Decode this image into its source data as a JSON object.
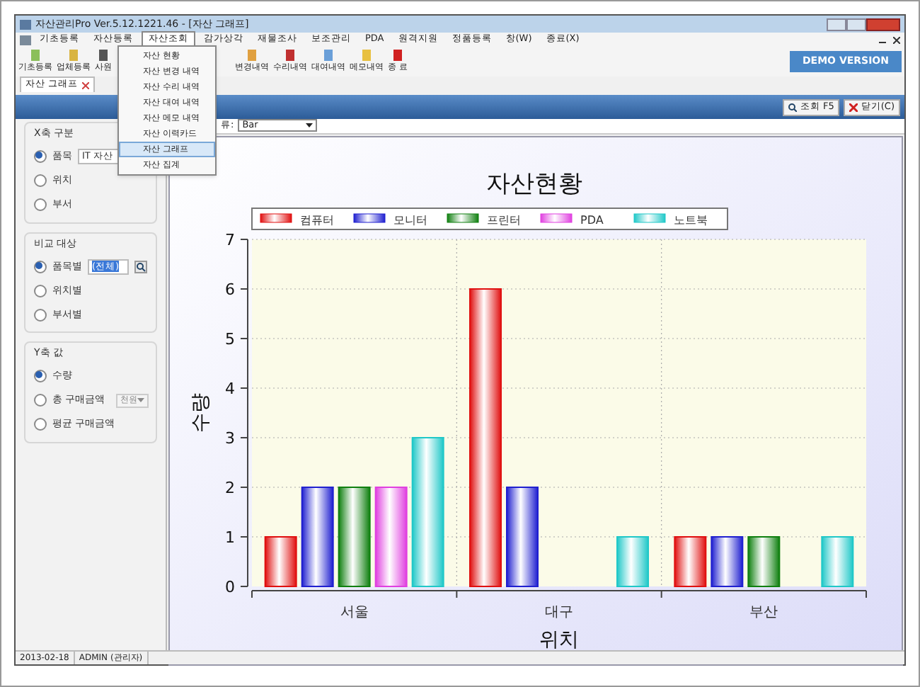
{
  "window": {
    "title": "자산관리Pro Ver.5.12.1221.46 - [자산 그래프]"
  },
  "menu": [
    {
      "label": "기초등록",
      "selected": false
    },
    {
      "label": "자산등록",
      "selected": false
    },
    {
      "label": "자산조회",
      "selected": true
    },
    {
      "label": "감가상각",
      "selected": false
    },
    {
      "label": "재물조사",
      "selected": false
    },
    {
      "label": "보조관리",
      "selected": false
    },
    {
      "label": "PDA",
      "selected": false
    },
    {
      "label": "원격지원",
      "selected": false
    },
    {
      "label": "정품등록",
      "selected": false
    },
    {
      "label": "창(W)",
      "selected": false
    },
    {
      "label": "종료(X)",
      "selected": false
    }
  ],
  "demo_badge": "DEMO VERSION",
  "toolbar": [
    {
      "label": "기초등록"
    },
    {
      "label": "업체등록"
    },
    {
      "label": "사원"
    },
    {
      "label": "변경내역"
    },
    {
      "label": "수리내역"
    },
    {
      "label": "대여내역"
    },
    {
      "label": "메모내역"
    },
    {
      "label": "종 료"
    }
  ],
  "dropdown": [
    {
      "label": "자산 현황",
      "selected": false
    },
    {
      "label": "자산 변경 내역",
      "selected": false
    },
    {
      "label": "자산 수리 내역",
      "selected": false
    },
    {
      "label": "자산 대여 내역",
      "selected": false
    },
    {
      "label": "자산 메모 내역",
      "selected": false
    },
    {
      "label": "자산 이력카드",
      "selected": false
    },
    {
      "label": "자산 그래프",
      "selected": true
    },
    {
      "label": "자산 집계",
      "selected": false
    }
  ],
  "doc_tab": {
    "label": "자산 그래프"
  },
  "header_buttons": [
    {
      "label": "조회 F5"
    },
    {
      "label": "닫기(C)"
    }
  ],
  "x_axis_group": {
    "title": "X축 구분",
    "options": [
      {
        "label": "품목",
        "selected": true,
        "value": "IT 자산"
      },
      {
        "label": "위치",
        "selected": false
      },
      {
        "label": "부서",
        "selected": false
      }
    ]
  },
  "compare_group": {
    "title": "비교 대상",
    "options": [
      {
        "label": "품목별",
        "selected": true,
        "value": "(전체)"
      },
      {
        "label": "위치별",
        "selected": false
      },
      {
        "label": "부서별",
        "selected": false
      }
    ]
  },
  "y_axis_group": {
    "title": "Y축 값",
    "options": [
      {
        "label": "수량",
        "selected": true
      },
      {
        "label": "총 구매금액",
        "selected": false,
        "unit": "천원"
      },
      {
        "label": "평균 구매금액",
        "selected": false
      }
    ]
  },
  "chart_type": {
    "label": "류:",
    "value": "Bar"
  },
  "chart_data": {
    "type": "bar",
    "grid": true,
    "legend": true,
    "title": "자산현황",
    "xlabel": "위치",
    "ylabel": "수량",
    "categories": [
      "서울",
      "대구",
      "부산"
    ],
    "ylim": [
      0,
      7
    ],
    "yticks": [
      0,
      1,
      2,
      3,
      4,
      5,
      6,
      7
    ],
    "series": [
      {
        "name": "컴퓨터",
        "color": "#e01010",
        "values": [
          1,
          6,
          1
        ]
      },
      {
        "name": "모니터",
        "color": "#2020d0",
        "values": [
          2,
          2,
          1
        ]
      },
      {
        "name": "프린터",
        "color": "#108010",
        "values": [
          2,
          0,
          1
        ]
      },
      {
        "name": "PDA",
        "color": "#e040e0",
        "values": [
          2,
          0,
          0
        ]
      },
      {
        "name": "노트북",
        "color": "#20c8c8",
        "values": [
          3,
          1,
          1
        ]
      }
    ]
  },
  "status_bar": [
    "2013-02-18",
    "ADMIN (관리자)"
  ]
}
